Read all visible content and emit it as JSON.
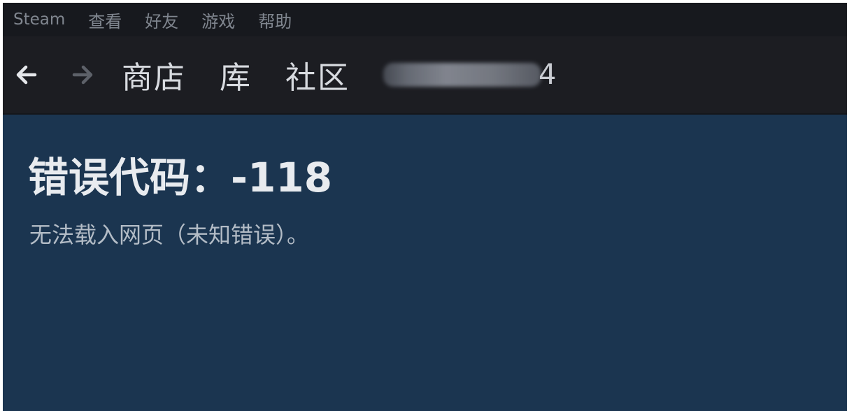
{
  "menubar": {
    "items": [
      "Steam",
      "查看",
      "好友",
      "游戏",
      "帮助"
    ]
  },
  "navbar": {
    "back_icon": "arrow-left-icon",
    "forward_icon": "arrow-right-icon",
    "store": "商店",
    "library": "库",
    "community": "社区",
    "username_tail": "4"
  },
  "error": {
    "title": "错误代码：-118",
    "message": "无法载入网页（未知错误）。"
  },
  "colors": {
    "content_bg": "#1b3550",
    "menubar_bg": "#17191e",
    "navbar_bg": "#1c1d22"
  }
}
